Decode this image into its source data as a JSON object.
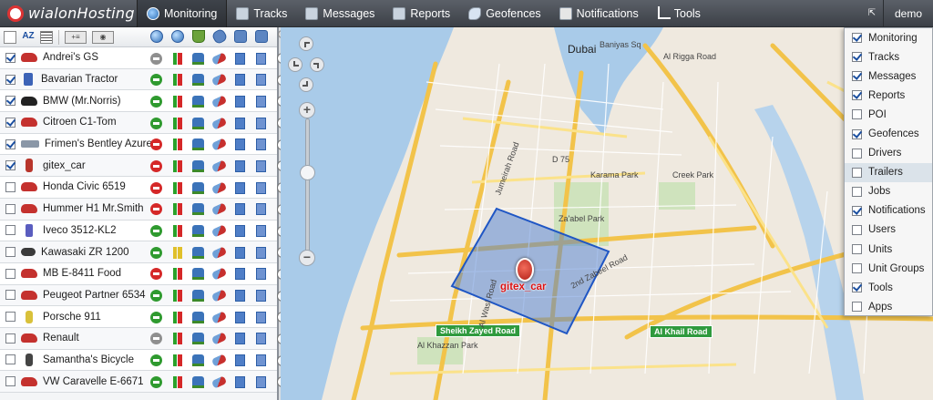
{
  "app": {
    "logo_text": "wialonHosting",
    "user": "demo",
    "expand_glyph": "⇱"
  },
  "nav": {
    "tabs": [
      {
        "label": "Monitoring",
        "icon": "globe-icon",
        "active": true
      },
      {
        "label": "Tracks",
        "icon": "tracks-icon"
      },
      {
        "label": "Messages",
        "icon": "messages-icon"
      },
      {
        "label": "Reports",
        "icon": "reports-icon"
      },
      {
        "label": "Geofences",
        "icon": "geofences-icon"
      },
      {
        "label": "Notifications",
        "icon": "notifications-icon"
      },
      {
        "label": "Tools",
        "icon": "tools-icon"
      }
    ]
  },
  "toolbar": {
    "sort_label": "AZ",
    "add_label": "+≡",
    "toggle_label": "◉"
  },
  "units": [
    {
      "name": "Andrei's GS",
      "checked": true,
      "icon": "car",
      "status": "gray",
      "bars": [
        "g",
        "r"
      ]
    },
    {
      "name": "Bavarian Tractor",
      "checked": true,
      "icon": "truck",
      "status": "green",
      "bars": [
        "g",
        "r"
      ]
    },
    {
      "name": "BMW (Mr.Norris)",
      "checked": true,
      "icon": "car-black",
      "status": "green",
      "bars": [
        "g",
        "r"
      ]
    },
    {
      "name": "Citroen C1-Tom",
      "checked": true,
      "icon": "car",
      "status": "green",
      "bars": [
        "g",
        "r"
      ]
    },
    {
      "name": "Frimen's Bentley Azure",
      "checked": true,
      "icon": "bus",
      "status": "red",
      "bars": [
        "g",
        "r"
      ]
    },
    {
      "name": "gitex_car",
      "checked": true,
      "icon": "tall",
      "status": "red",
      "bars": [
        "g",
        "r"
      ]
    },
    {
      "name": "Honda Civic 6519",
      "checked": false,
      "icon": "car",
      "status": "red",
      "bars": [
        "g",
        "r"
      ]
    },
    {
      "name": "Hummer H1 Mr.Smith",
      "checked": false,
      "icon": "car",
      "status": "red",
      "bars": [
        "g",
        "r"
      ]
    },
    {
      "name": "Iveco 3512-KL2",
      "checked": false,
      "icon": "van",
      "status": "green",
      "bars": [
        "g",
        "r"
      ]
    },
    {
      "name": "Kawasaki ZR 1200",
      "checked": false,
      "icon": "moto",
      "status": "green",
      "bars": [
        "y",
        "y"
      ]
    },
    {
      "name": "MB E-8411 Food",
      "checked": false,
      "icon": "car",
      "status": "red",
      "bars": [
        "g",
        "r"
      ]
    },
    {
      "name": "Peugeot Partner 6534",
      "checked": false,
      "icon": "car",
      "status": "green",
      "bars": [
        "g",
        "r"
      ]
    },
    {
      "name": "Porsche 911",
      "checked": false,
      "icon": "yellow",
      "status": "green",
      "bars": [
        "g",
        "r"
      ]
    },
    {
      "name": "Renault",
      "checked": false,
      "icon": "car",
      "status": "gray",
      "bars": [
        "g",
        "r"
      ]
    },
    {
      "name": "Samantha's Bicycle",
      "checked": false,
      "icon": "bike",
      "status": "green",
      "bars": [
        "g",
        "r"
      ]
    },
    {
      "name": "VW Caravelle E-6671",
      "checked": false,
      "icon": "car",
      "status": "green",
      "bars": [
        "g",
        "r"
      ]
    }
  ],
  "map": {
    "unit_label": "gitex_car",
    "labels": [
      {
        "text": "Dubai",
        "big": true
      },
      {
        "text": "Baniyas Sq"
      },
      {
        "text": "Al Rigga Road"
      },
      {
        "text": "Za'abel Park"
      },
      {
        "text": "Karama Park"
      },
      {
        "text": "Creek Park"
      },
      {
        "text": "Al Khazzan Park"
      },
      {
        "text": "Sheikh Zayed Road",
        "green": true
      },
      {
        "text": "Al Khail Road",
        "green": true
      },
      {
        "text": "2nd Zabeel Road"
      },
      {
        "text": "Jumeirah Road"
      },
      {
        "text": "Al Wasl Road"
      },
      {
        "text": "D 75"
      }
    ]
  },
  "layers_menu": {
    "items": [
      {
        "label": "Monitoring",
        "checked": true
      },
      {
        "label": "Tracks",
        "checked": true
      },
      {
        "label": "Messages",
        "checked": true
      },
      {
        "label": "Reports",
        "checked": true
      },
      {
        "label": "POI",
        "checked": false
      },
      {
        "label": "Geofences",
        "checked": true
      },
      {
        "label": "Drivers",
        "checked": false
      },
      {
        "label": "Trailers",
        "checked": false,
        "hover": true
      },
      {
        "label": "Jobs",
        "checked": false
      },
      {
        "label": "Notifications",
        "checked": true
      },
      {
        "label": "Users",
        "checked": false
      },
      {
        "label": "Units",
        "checked": false
      },
      {
        "label": "Unit Groups",
        "checked": false
      },
      {
        "label": "Tools",
        "checked": true
      },
      {
        "label": "Apps",
        "checked": false
      }
    ]
  },
  "colors": {
    "accent": "#2b6cb3",
    "ok": "#2f9a2f",
    "alarm": "#d52828",
    "geofence": "#3b6fd1"
  }
}
